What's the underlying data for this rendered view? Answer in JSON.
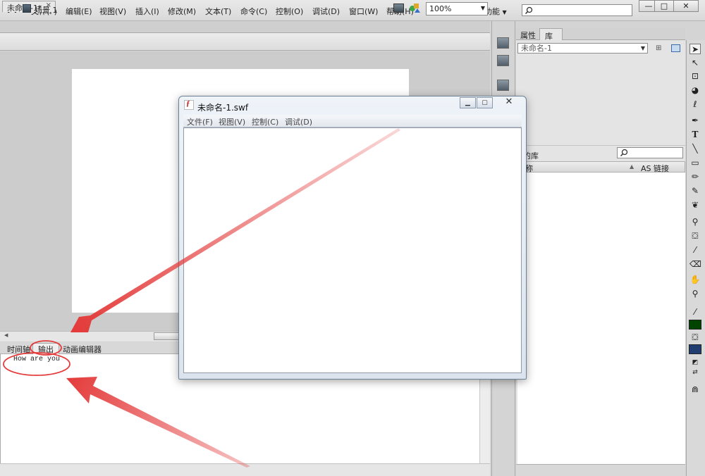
{
  "app": {
    "logo": "Fl"
  },
  "menu": {
    "items": [
      "文件(F)",
      "编辑(E)",
      "视图(V)",
      "插入(I)",
      "修改(M)",
      "文本(T)",
      "命令(C)",
      "控制(O)",
      "调试(D)",
      "窗口(W)",
      "帮助(H)"
    ],
    "workspace": "基本功能",
    "search_placeholder": ""
  },
  "window_controls": {
    "minimize": "—",
    "maximize": "□",
    "close": "✕"
  },
  "document": {
    "tab_label": "未命名-1*",
    "tab_close": "×"
  },
  "scene": {
    "label": "场景 1",
    "zoom": "100%"
  },
  "bottom_panel": {
    "tabs": [
      "时间轴",
      "输出",
      "动画编辑器"
    ],
    "active_tab": "输出",
    "output_text": "How are you"
  },
  "right_panel": {
    "tabs": [
      "属性",
      "库"
    ],
    "active_tab": "库",
    "library_select": "未命名-1",
    "library_count_label": "的库",
    "columns": {
      "name": "称",
      "link": "AS 链接"
    }
  },
  "swf_window": {
    "title": "未命名-1.swf",
    "menu": [
      "文件(F)",
      "视图(V)",
      "控制(C)",
      "调试(D)"
    ]
  },
  "colors": {
    "annotation_red": "#e43a3a",
    "stroke_color": "#004400",
    "fill_color": "#1f3d6e"
  },
  "icons": {
    "toolbox": [
      "selection-tool-icon",
      "subselection-tool-icon",
      "free-transform-tool-icon",
      "3d-rotation-tool-icon",
      "lasso-tool-icon",
      "pen-tool-icon",
      "text-tool-icon",
      "line-tool-icon",
      "rectangle-tool-icon",
      "pencil-tool-icon",
      "brush-tool-icon",
      "deco-tool-icon",
      "bone-tool-icon",
      "paint-bucket-tool-icon",
      "eyedropper-tool-icon",
      "eraser-tool-icon",
      "hand-tool-icon",
      "zoom-tool-icon"
    ]
  }
}
